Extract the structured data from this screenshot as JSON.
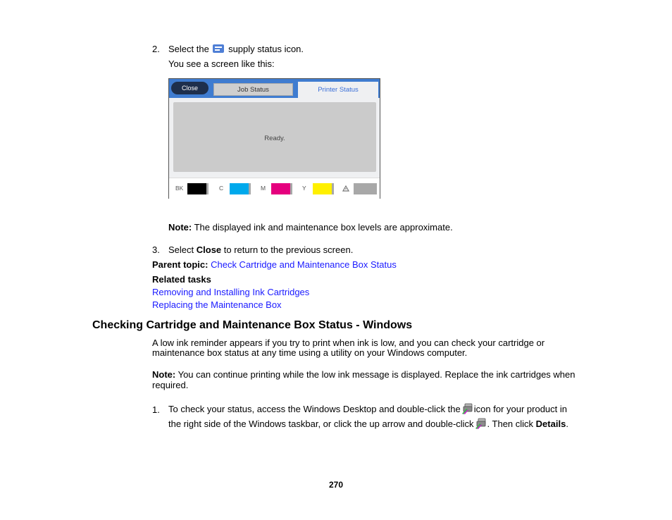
{
  "step2": {
    "number": "2.",
    "text_before": "Select the",
    "icon": "supply-status-icon",
    "text_after": "supply status icon.",
    "followup": "You see a screen like this:"
  },
  "printer_screen": {
    "close_button": "Close",
    "tabs": [
      {
        "label": "Job Status",
        "active": false
      },
      {
        "label": "Printer Status",
        "active": true
      }
    ],
    "status_message": "Ready.",
    "inks": [
      {
        "label": "BK",
        "color": "#000000",
        "level": 0.9
      },
      {
        "label": "C",
        "color": "#00a9ec",
        "level": 0.9
      },
      {
        "label": "M",
        "color": "#e5007e",
        "level": 0.9
      },
      {
        "label": "Y",
        "color": "#fff000",
        "level": 0.9
      },
      {
        "label": "maintenance-box-icon",
        "color": "#a8a8a8",
        "level": 1.0
      }
    ]
  },
  "note1": {
    "label": "Note:",
    "text": " The displayed ink and maintenance box levels are approximate."
  },
  "step3": {
    "number": "3.",
    "before": "Select ",
    "bold": "Close",
    "after": " to return to the previous screen."
  },
  "parent_topic": {
    "label": "Parent topic:",
    "link": "Check Cartridge and Maintenance Box Status"
  },
  "related_tasks": {
    "label": "Related tasks",
    "links": [
      "Removing and Installing Ink Cartridges",
      "Replacing the Maintenance Box"
    ]
  },
  "section": {
    "heading": "Checking Cartridge and Maintenance Box Status - Windows",
    "intro_line1": "A low ink reminder appears if you try to print when ink is low, and you can check your cartridge or",
    "intro_line2": "maintenance box status at any time using a utility on your Windows computer.",
    "note_label": "Note:",
    "note_line1": " You can continue printing while the low ink message is displayed. Replace the ink cartridges when",
    "note_line2": "required.",
    "step1": {
      "number": "1.",
      "line1_before": "To check your status, access the Windows Desktop and double-click the",
      "line1_after": "icon for your product in",
      "line2_before": "the right side of the Windows taskbar, or click the up arrow and double-click",
      "line2_after": ". Then click ",
      "line2_bold": "Details",
      "line2_end": "."
    }
  },
  "page_number": "270"
}
